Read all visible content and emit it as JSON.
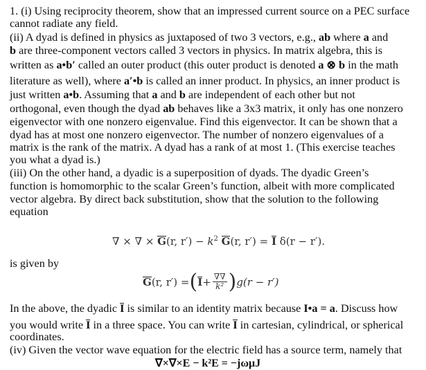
{
  "document": {
    "lines": [
      "1. (i) Using reciprocity theorem, show that an impressed current source on a PEC surface",
      "cannot radiate any field.",
      "(ii) A dyad is defined in physics as juxtaposed of two 3 vectors, e.g., ",
      "ab",
      " where ",
      "a",
      " and",
      "b",
      " are three-component vectors called 3 vectors in physics.  In matrix algebra, this is",
      "written as ",
      "a•b′",
      " called an outer product (this outer product is denoted ",
      "a ⊗ b",
      " in the math",
      "literature as well), where ",
      "a′•b",
      " is called an inner product.  In physics, an inner product is",
      "just written ",
      "a•b",
      ". Assuming that ",
      "a",
      " and ",
      "b",
      " are independent of each other but not",
      "orthogonal, even though the dyad ",
      "ab",
      " behaves like a 3x3 matrix, it only has one nonzero",
      "eigenvector with one nonzero eigenvalue.  Find this eigenvector.  It can be shown that a",
      "dyad has at most one nonzero eigenvector.  The number of nonzero eigenvalues of a",
      "matrix is the rank of the matrix.  A dyad has a rank of at most 1.  (This exercise teaches",
      "you what a dyad is.)",
      "(iii)  On the other hand, a dyadic is a superposition of dyads.  The dyadic Green’s",
      "function is homomorphic to the scalar Green’s function, albeit with more complicated",
      "vector algebra.  By direct back substitution, show that the solution to the following",
      "equation"
    ],
    "equation1": "∇ × ∇ × G(r, r′) − k² G(r, r′) = I δ(r − r′).",
    "eq1_parts": {
      "curl": "∇ × ∇ × ",
      "G": "G",
      "args": "(r, r′)",
      "minus_k": " − k",
      "sq": "2",
      "eq_I": " = ",
      "I": "I",
      "delta": " δ(r − r′)."
    },
    "given_by": "is given by",
    "eq2_parts": {
      "G": "G",
      "args": "(r, r′) = ",
      "lparen": "(",
      "I": "I",
      "plus": " + ",
      "num": "∇∇",
      "den": "k²",
      "rparen": ")",
      "g": " g(r − r′)"
    },
    "para_above": {
      "p1": "In the above, the dyadic ",
      "I": "I",
      "p2": " is similar to an identity matrix because ",
      "Ia": "I•a = a",
      "p3": ".  Discuss how",
      "p4": "you would write ",
      "p5": " in a three space.  You can write ",
      "p6": "  in cartesian, cylindrical, or spherical",
      "p7": "coordinates."
    },
    "part_iv": "(iv)  Given the vector wave equation for the electric field has a source term, namely that",
    "eq3": "∇×∇×E − k²E = −jωμJ"
  }
}
